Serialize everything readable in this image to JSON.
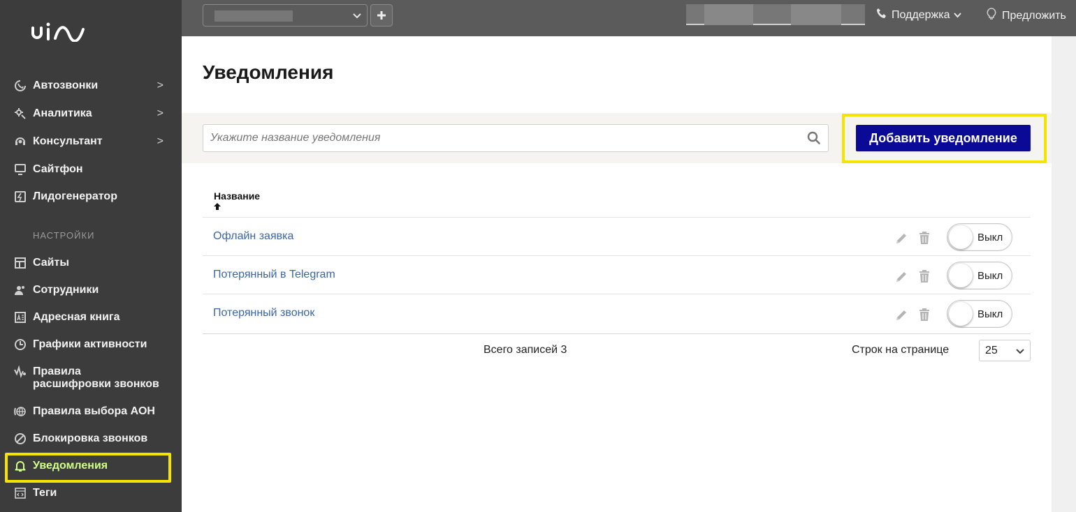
{
  "sidebar": {
    "items": [
      {
        "label": "Автозвонки",
        "icon": "autocall-icon",
        "chevron": ">"
      },
      {
        "label": "Аналитика",
        "icon": "analytics-icon",
        "chevron": ">"
      },
      {
        "label": "Консультант",
        "icon": "consultant-icon",
        "chevron": ">"
      },
      {
        "label": "Сайтфон",
        "icon": "sitephone-icon"
      },
      {
        "label": "Лидогенератор",
        "icon": "leadgen-icon"
      }
    ],
    "settings_title": "НАСТРОЙКИ",
    "settings_items": [
      {
        "label": "Сайты",
        "icon": "sites-icon"
      },
      {
        "label": "Сотрудники",
        "icon": "employees-icon"
      },
      {
        "label": "Адресная книга",
        "icon": "address-book-icon"
      },
      {
        "label": "Графики активности",
        "icon": "activity-chart-icon"
      },
      {
        "label_line1": "Правила",
        "label_line2": "расшифровки звонков",
        "icon": "transcription-rules-icon"
      },
      {
        "label": "Правила выбора АОН",
        "icon": "caller-id-rules-icon"
      },
      {
        "label": "Блокировка звонков",
        "icon": "block-calls-icon"
      },
      {
        "label": "Уведомления",
        "icon": "bell-icon",
        "active": true
      },
      {
        "label": "Теги",
        "icon": "tags-icon"
      }
    ]
  },
  "topbar": {
    "support_label": "Поддержка",
    "suggest_label": "Предложить"
  },
  "page": {
    "title": "Уведомления"
  },
  "search": {
    "placeholder": "Укажите название уведомления"
  },
  "add_button_label": "Добавить уведомление",
  "table": {
    "column_name": "Название",
    "sort_indicator": "🠉",
    "rows": [
      {
        "name": "Офлайн заявка",
        "toggle": "Выкл"
      },
      {
        "name": "Потерянный в Telegram",
        "toggle": "Выкл"
      },
      {
        "name": "Потерянный звонок",
        "toggle": "Выкл"
      }
    ]
  },
  "footer": {
    "total": "Всего записей 3",
    "rows_per_page_label": "Строк на странице",
    "rows_per_page_value": "25"
  },
  "colors": {
    "sidebar_bg": "#3c3c3c",
    "topbar_bg": "#5b5b5b",
    "active_item": "#d2ff8a",
    "primary_button": "#0a0a96",
    "link": "#3a66a8",
    "highlight": "#f5e400"
  }
}
